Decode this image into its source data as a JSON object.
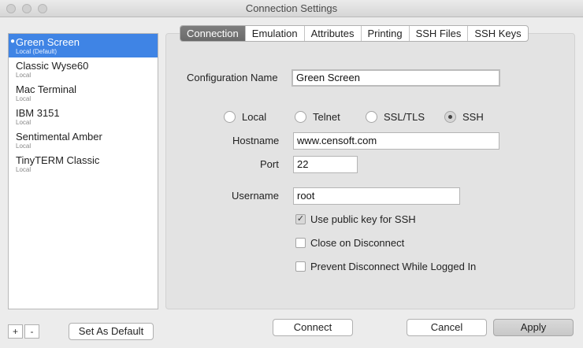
{
  "window": {
    "title": "Connection Settings"
  },
  "sidebar": {
    "profiles": [
      {
        "name": "Green Screen",
        "sub": "Local  (Default)",
        "selected": true
      },
      {
        "name": "Classic Wyse60",
        "sub": "Local"
      },
      {
        "name": "Mac Terminal",
        "sub": "Local"
      },
      {
        "name": "IBM 3151",
        "sub": "Local"
      },
      {
        "name": "Sentimental Amber",
        "sub": "Local"
      },
      {
        "name": "TinyTERM Classic",
        "sub": "Local"
      }
    ],
    "add_label": "+",
    "remove_label": "-",
    "set_default_label": "Set As Default"
  },
  "tabs": [
    "Connection",
    "Emulation",
    "Attributes",
    "Printing",
    "SSH Files",
    "SSH Keys"
  ],
  "form": {
    "config_name_label": "Configuration Name",
    "config_name_value": "Green Screen",
    "protocols": [
      "Local",
      "Telnet",
      "SSL/TLS",
      "SSH"
    ],
    "selected_protocol": "SSH",
    "hostname_label": "Hostname",
    "hostname_value": "www.censoft.com",
    "port_label": "Port",
    "port_value": "22",
    "username_label": "Username",
    "username_value": "root",
    "checks": [
      {
        "label": "Use public key for SSH",
        "checked": true
      },
      {
        "label": "Close on Disconnect",
        "checked": false
      },
      {
        "label": "Prevent Disconnect While Logged In",
        "checked": false
      }
    ]
  },
  "footer": {
    "connect_label": "Connect",
    "cancel_label": "Cancel",
    "apply_label": "Apply"
  }
}
